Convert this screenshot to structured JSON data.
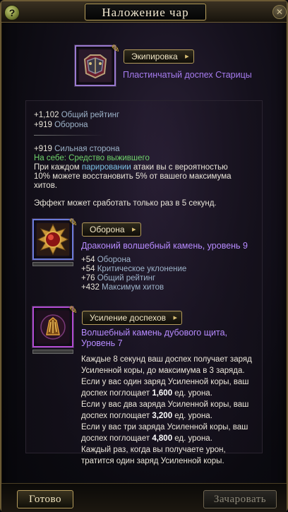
{
  "window": {
    "title": "Наложение чар",
    "help_glyph": "?",
    "close_glyph": "✕"
  },
  "equipment": {
    "category": "Экипировка",
    "item_name": "Пластинчатый доспех Старицы",
    "icon": "armor-chest-icon"
  },
  "item_stats": [
    {
      "value": "+1,102",
      "label": "Общий рейтинг"
    },
    {
      "value": "+919",
      "label": "Оборона"
    }
  ],
  "strong_side": {
    "value": "+919",
    "label": "Сильная сторона"
  },
  "set_bonus": {
    "prefix": "На себе:",
    "name": "Средство выжившего",
    "line1_a": "При каждом",
    "line1_keyword": "парировании",
    "line1_b": "атаки вы с вероятностью",
    "line2": "10% можете восстановить 5% от вашего максимума",
    "line3": "хитов.",
    "line4": "Эффект может сработать только раз в 5 секунд."
  },
  "defense_slot": {
    "category": "Оборона",
    "rune_name": "Драконий волшебный камень, уровень 9",
    "icon": "red-gem-icon",
    "stats": [
      {
        "value": "+54",
        "label": "Оборона"
      },
      {
        "value": "+54",
        "label": "Критическое уклонение"
      },
      {
        "value": "+76",
        "label": "Общий рейтинг"
      },
      {
        "value": "+432",
        "label": "Максимум хитов"
      }
    ]
  },
  "armor_slot": {
    "category": "Усиление доспехов",
    "rune_name_line1": "Волшебный камень дубового щита,",
    "rune_name_line2": "Уровень 7",
    "icon": "oak-shield-gem-icon",
    "desc": [
      [
        "Каждые 8 секунд ваш доспех получает заряд",
        ""
      ],
      [
        "Усиленной коры, до максимума в 3 заряда.",
        ""
      ],
      [
        "Если у вас один заряд Усиленной коры, ваш",
        ""
      ],
      [
        "доспех поглощает ",
        "1,600",
        " ед. урона."
      ],
      [
        "Если у вас два заряда Усиленной коры, ваш",
        ""
      ],
      [
        "доспех поглощает ",
        "3,200",
        " ед. урона."
      ],
      [
        "Если у вас три заряда Усиленной коры, ваш",
        ""
      ],
      [
        "доспех поглощает ",
        "4,800",
        " ед. урона."
      ],
      [
        "Каждый раз, когда вы получаете урон,",
        ""
      ],
      [
        "тратится один заряд Усиленной коры.",
        ""
      ]
    ]
  },
  "footer": {
    "done_label": "Готово",
    "enchant_label": "Зачаровать"
  },
  "colors": {
    "gold_border": "#b59c5c",
    "stat_label": "#9db3c9",
    "set_green": "#6fd46b",
    "keyword_blue": "#7ec2e6",
    "rune_purple": "#b78bff"
  }
}
